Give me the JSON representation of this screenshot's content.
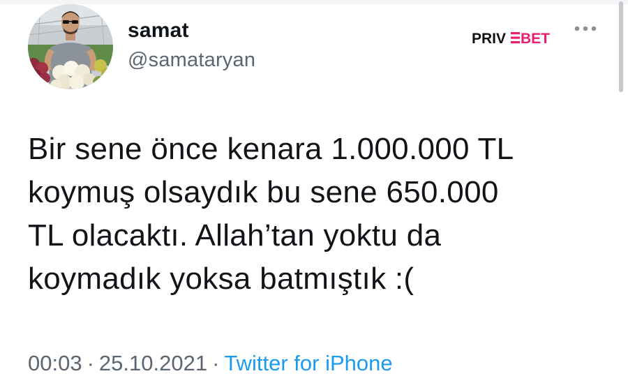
{
  "tweet": {
    "author": {
      "display_name": "samat",
      "handle": "@samataryan"
    },
    "text": "Bir sene önce kenara 1.000.000 TL\nkoymuş olsaydık bu sene 650.000\nTL olacaktı. Allah’tan yoktu da\nkoymadık yoksa batmıştık :(",
    "time": "00:03",
    "date": "25.10.2021",
    "separator": "·",
    "source": "Twitter for iPhone"
  },
  "watermark": {
    "part1": "PRIV",
    "part2": "BET",
    "color": "#ec1e6e"
  },
  "icons": {
    "more": "more-horizontal-icon"
  }
}
